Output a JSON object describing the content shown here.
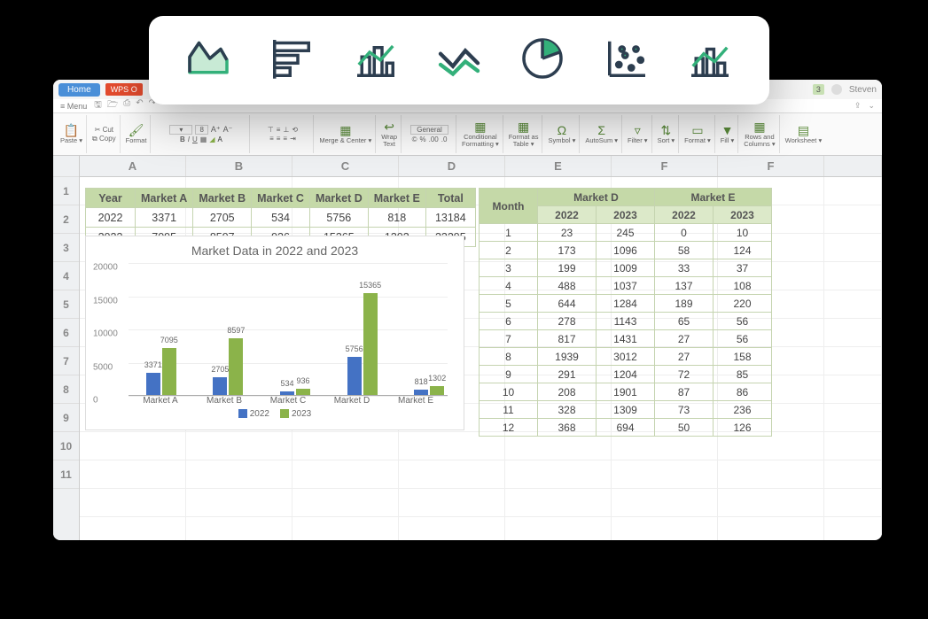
{
  "titlebar": {
    "home": "Home",
    "app": "WPS O",
    "notif": "3",
    "user": "Steven"
  },
  "menubar": {
    "menu": "Menu"
  },
  "ribbon": {
    "paste": "Paste ▾",
    "cut": "Cut",
    "copy": "Copy",
    "format": "Format",
    "bold": "B",
    "italic": "I",
    "underline": "U",
    "font_size": "8",
    "merge": "Merge & Center ▾",
    "wrap": "Wrap\nText",
    "general": "General",
    "cond": "Conditional\nFormatting ▾",
    "fmt_table": "Format as\nTable ▾",
    "symbol": "Symbol ▾",
    "autosum": "AutoSum ▾",
    "filter": "Filter ▾",
    "sort": "Sort ▾",
    "format_btn": "Format ▾",
    "fill": "Fill ▾",
    "rows_cols": "Rows and\nColumns ▾",
    "worksheet": "Worksheet ▾"
  },
  "columns": [
    "A",
    "B",
    "C",
    "D",
    "E",
    "F",
    "F"
  ],
  "row_numbers": [
    "1",
    "2",
    "3",
    "4",
    "5",
    "6",
    "7",
    "8",
    "9",
    "10",
    "11"
  ],
  "table1": {
    "headers": [
      "Year",
      "Market A",
      "Market B",
      "Market C",
      "Market D",
      "Market E",
      "Total"
    ],
    "rows": [
      [
        "2022",
        "3371",
        "2705",
        "534",
        "5756",
        "818",
        "13184"
      ],
      [
        "2023",
        "7095",
        "8597",
        "936",
        "15365",
        "1302",
        "33295"
      ]
    ]
  },
  "table2": {
    "top": [
      "Market D",
      "Market E"
    ],
    "sub": [
      "Month",
      "2022",
      "2023",
      "2022",
      "2023"
    ],
    "rows": [
      [
        "1",
        "23",
        "245",
        "0",
        "10"
      ],
      [
        "2",
        "173",
        "1096",
        "58",
        "124"
      ],
      [
        "3",
        "199",
        "1009",
        "33",
        "37"
      ],
      [
        "4",
        "488",
        "1037",
        "137",
        "108"
      ],
      [
        "5",
        "644",
        "1284",
        "189",
        "220"
      ],
      [
        "6",
        "278",
        "1143",
        "65",
        "56"
      ],
      [
        "7",
        "817",
        "1431",
        "27",
        "56"
      ],
      [
        "8",
        "1939",
        "3012",
        "27",
        "158"
      ],
      [
        "9",
        "291",
        "1204",
        "72",
        "85"
      ],
      [
        "10",
        "208",
        "1901",
        "87",
        "86"
      ],
      [
        "11",
        "328",
        "1309",
        "73",
        "236"
      ],
      [
        "12",
        "368",
        "694",
        "50",
        "126"
      ]
    ]
  },
  "chart_data": {
    "type": "bar",
    "title": "Market Data in 2022 and 2023",
    "categories": [
      "Market A",
      "Market B",
      "Market C",
      "Market D",
      "Market E"
    ],
    "series": [
      {
        "name": "2022",
        "values": [
          3371,
          2705,
          534,
          5756,
          818
        ],
        "color": "#4472c4"
      },
      {
        "name": "2023",
        "values": [
          7095,
          8597,
          936,
          15365,
          1302
        ],
        "color": "#8bb34a"
      }
    ],
    "ylim": [
      0,
      20000
    ],
    "yticks": [
      0,
      5000,
      10000,
      15000,
      20000
    ],
    "xlabel": "",
    "ylabel": ""
  },
  "picker_icons": [
    "area-chart-icon",
    "horizontal-bar-icon",
    "bar-chart-icon",
    "line-chart-icon",
    "pie-chart-icon",
    "scatter-chart-icon",
    "combo-chart-icon"
  ]
}
